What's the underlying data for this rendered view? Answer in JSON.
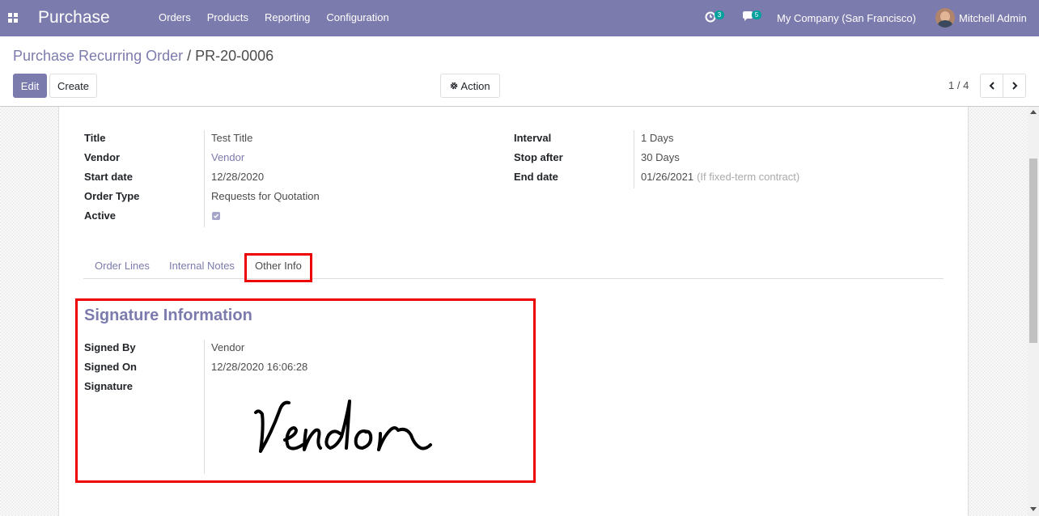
{
  "navbar": {
    "app_name": "Purchase",
    "menu": [
      "Orders",
      "Products",
      "Reporting",
      "Configuration"
    ],
    "activity_count": "3",
    "messages_count": "5",
    "company": "My Company (San Francisco)",
    "user": "Mitchell Admin"
  },
  "breadcrumb": {
    "parent": "Purchase Recurring Order",
    "separator": "/",
    "current": "PR-20-0006"
  },
  "buttons": {
    "edit": "Edit",
    "create": "Create",
    "action": "Action"
  },
  "pager": {
    "value": "1 / 4"
  },
  "form": {
    "left": [
      {
        "label": "Title",
        "value": "Test Title"
      },
      {
        "label": "Vendor",
        "value": "Vendor"
      },
      {
        "label": "Start date",
        "value": "12/28/2020"
      },
      {
        "label": "Order Type",
        "value": "Requests for Quotation"
      },
      {
        "label": "Active",
        "value": ""
      }
    ],
    "active_checked": true,
    "right": [
      {
        "label": "Interval",
        "value": "1 Days"
      },
      {
        "label": "Stop after",
        "value": "30 Days"
      },
      {
        "label": "End date",
        "value": "01/26/2021",
        "hint": "(If fixed-term contract)"
      }
    ]
  },
  "tabs": [
    "Order Lines",
    "Internal Notes",
    "Other Info"
  ],
  "active_tab": "Other Info",
  "signature_section": {
    "title": "Signature Information",
    "fields": [
      {
        "label": "Signed By",
        "value": "Vendor"
      },
      {
        "label": "Signed On",
        "value": "12/28/2020 16:06:28"
      },
      {
        "label": "Signature",
        "value": ""
      }
    ],
    "signature_text": "Vendor"
  },
  "colors": {
    "brand": "#7c7bad",
    "highlight": "#ee0000",
    "badge": "#00a09d"
  }
}
